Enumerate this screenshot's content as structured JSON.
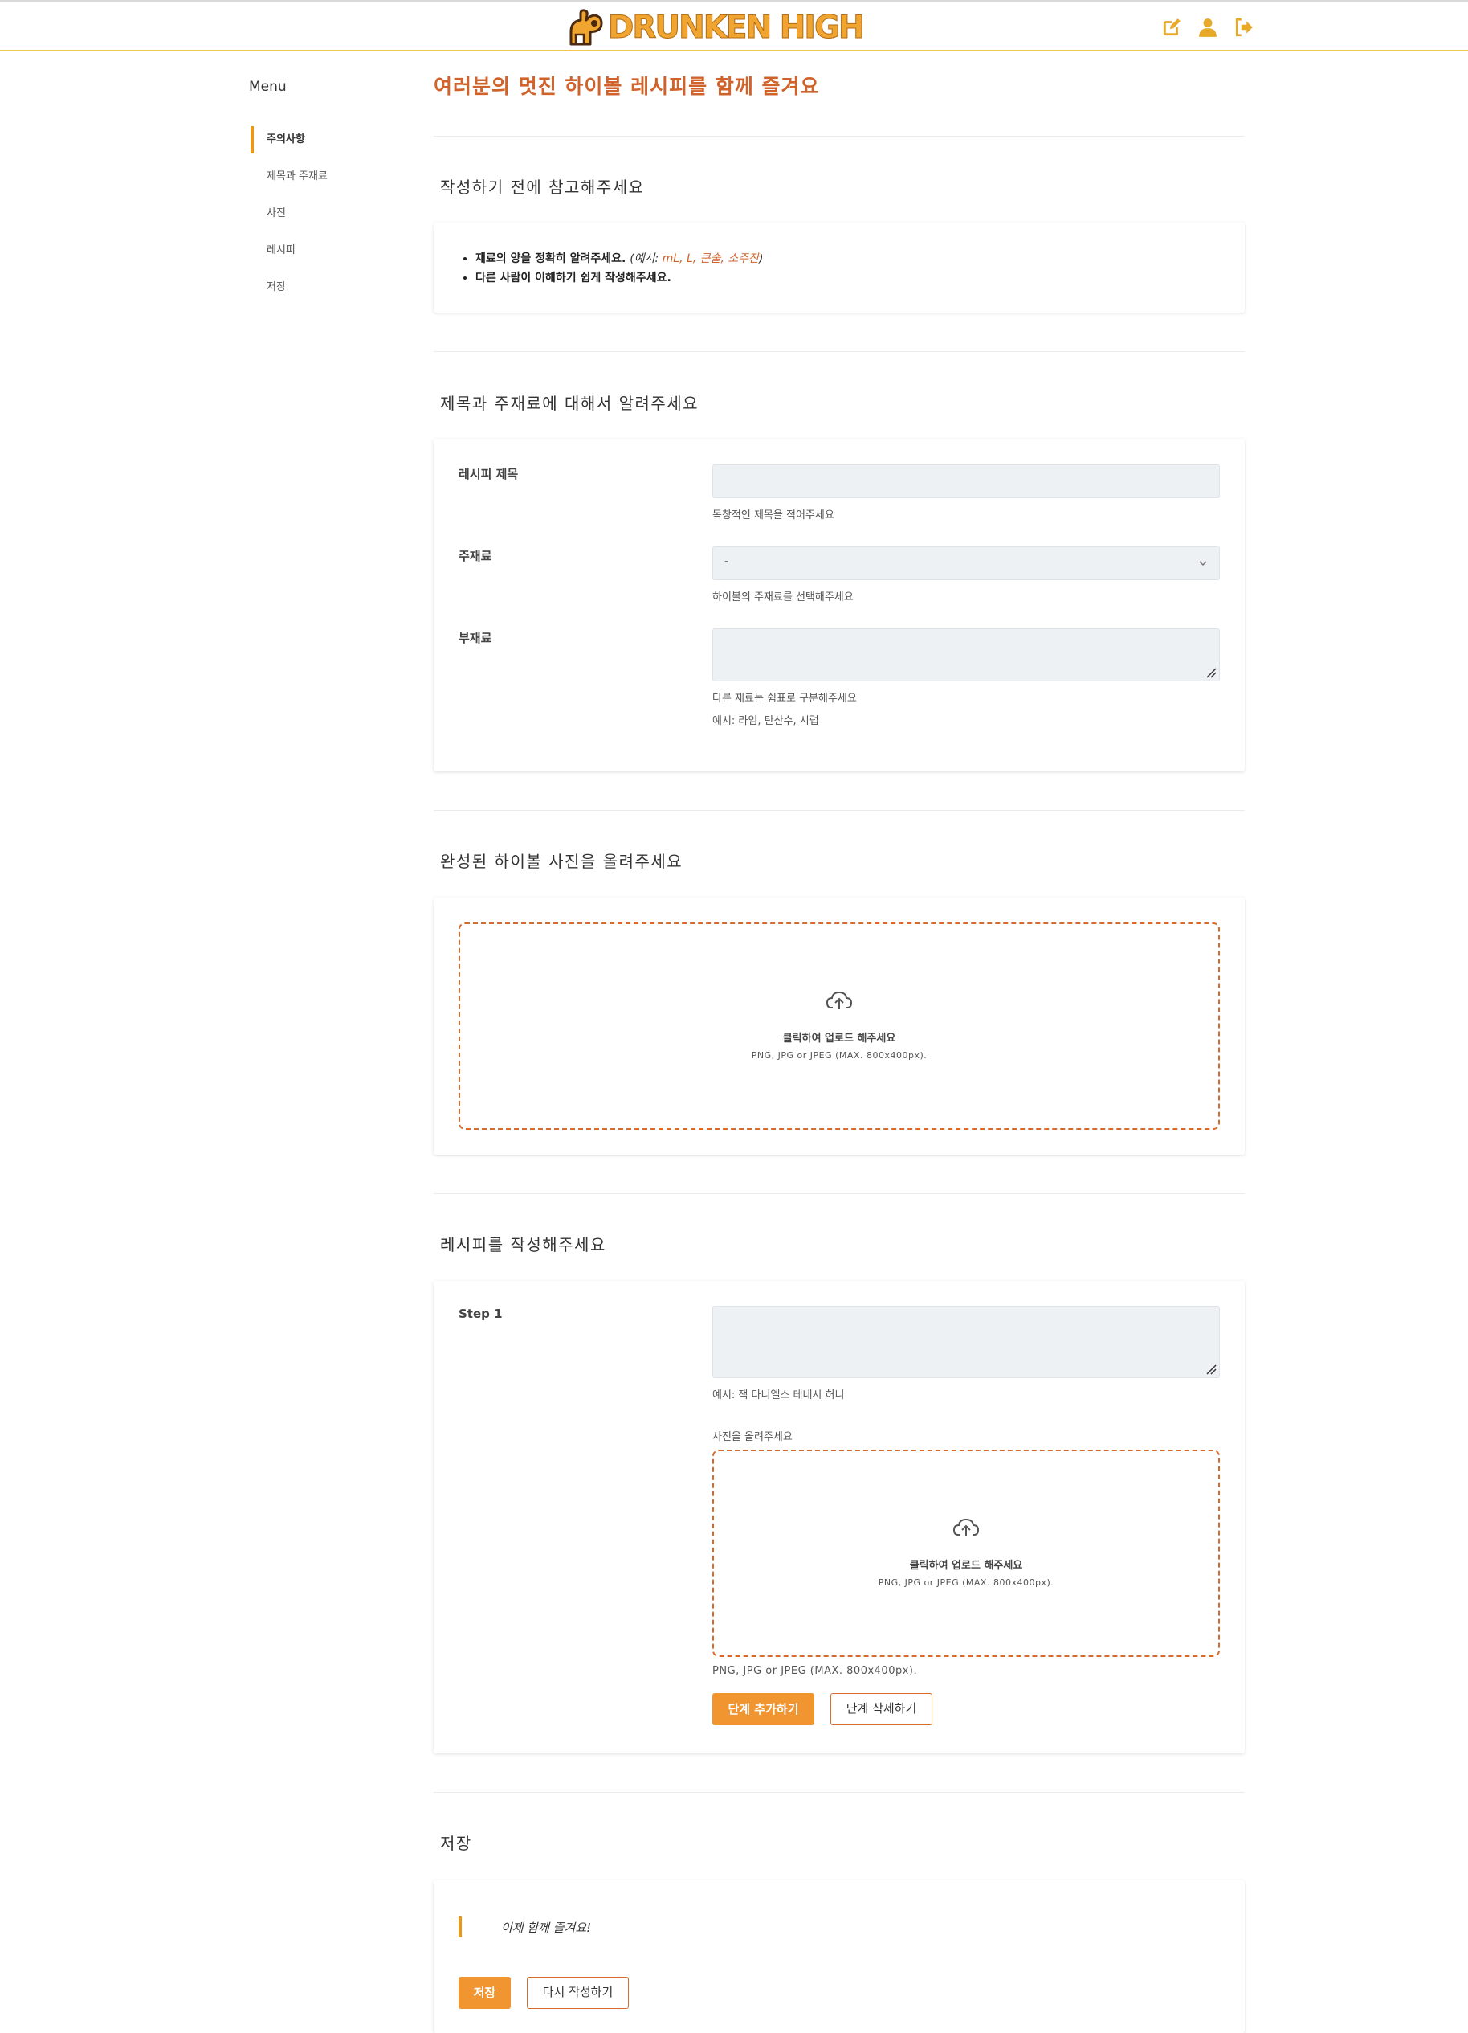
{
  "header": {
    "brand": "DRUNKEN HIGH",
    "icons": [
      "edit-icon",
      "user-icon",
      "logout-icon"
    ],
    "accent": "#f0a531"
  },
  "sidebar": {
    "title": "Menu",
    "items": [
      {
        "label": "주의사항",
        "active": true
      },
      {
        "label": "제목과 주재료"
      },
      {
        "label": "사진"
      },
      {
        "label": "레시피"
      },
      {
        "label": "저장"
      }
    ]
  },
  "page_title": "여러분의 멋진 하이볼 레시피를 함께 즐겨요",
  "notice": {
    "heading": "작성하기 전에 참고해주세요",
    "item1": "재료의 양을 정확히 알려주세요.",
    "item1_example_open": "(예시: ",
    "item1_example_values": "mL, L, 큰술, 소주잔",
    "item1_example_close": ")",
    "item2": "다른 사람이 이해하기 쉽게 작성해주세요."
  },
  "basics": {
    "heading": "제목과 주재료에 대해서 알려주세요",
    "title_label": "레시피 제목",
    "title_value": "",
    "title_hint": "독창적인 제목을 적어주세요",
    "main_label": "주재료",
    "main_value": "-",
    "main_hint": "하이볼의 주재료를 선택해주세요",
    "sub_label": "부재료",
    "sub_value": "",
    "sub_hint1": "다른 재료는 쉼표로 구분해주세요",
    "sub_hint2": "예시: 라임, 탄산수, 시럽"
  },
  "photo": {
    "heading": "완성된 하이볼 사진을 올려주세요",
    "upload_text": "클릭하여 업로드 해주세요",
    "upload_sub": "PNG, JPG or JPEG (MAX. 800x400px)."
  },
  "recipe": {
    "heading": "레시피를 작성해주세요",
    "step_label": "Step 1",
    "step_value": "",
    "step_hint": "예시: 잭 다니엘스 테네시 허니",
    "photo_label": "사진을 올려주세요",
    "upload_text": "클릭하여 업로드 해주세요",
    "upload_sub": "PNG, JPG or JPEG (MAX. 800x400px).",
    "upload_note": "PNG, JPG or JPEG (MAX. 800x400px).",
    "add_step": "단계 추가하기",
    "delete_step": "단계 삭제하기"
  },
  "save": {
    "heading": "저장",
    "quote": "이제 함께 즐겨요!",
    "save_button": "저장",
    "rewrite_button": "다시 작성하기"
  }
}
